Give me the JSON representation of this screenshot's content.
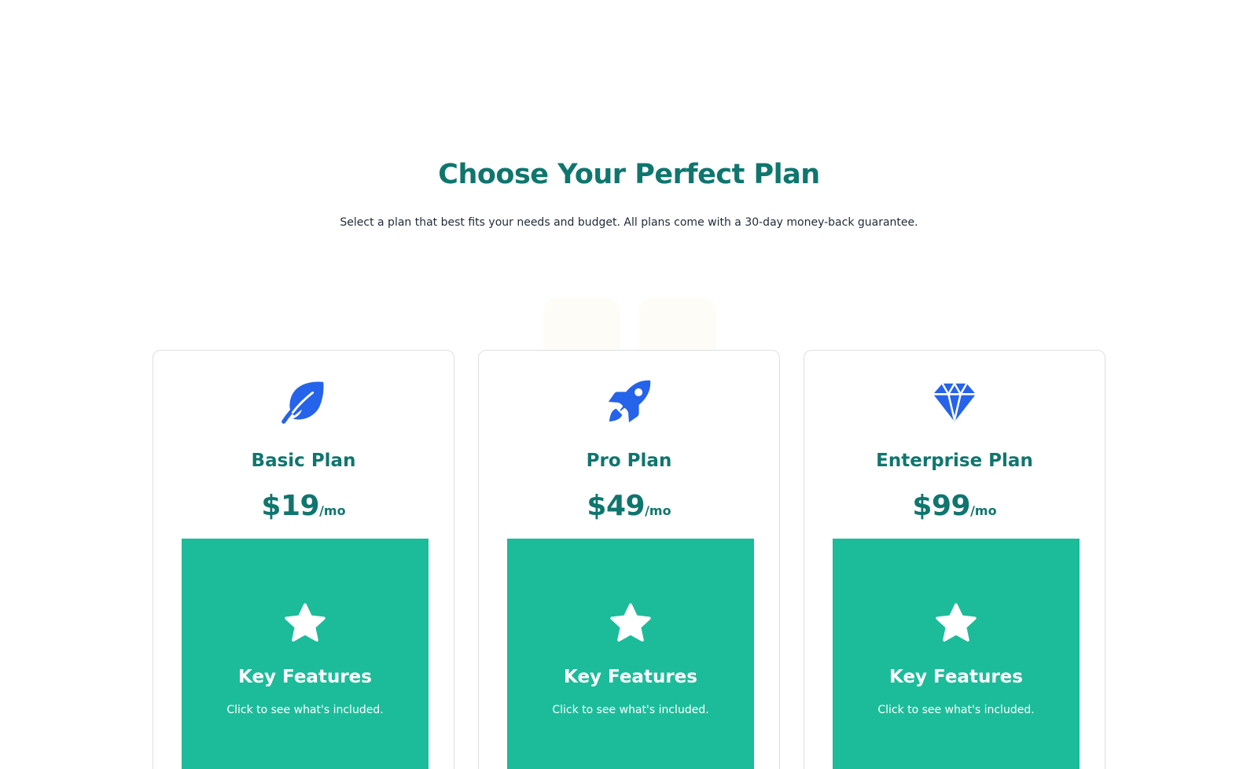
{
  "header": {
    "title": "Choose Your Perfect Plan",
    "subtitle": "Select a plan that best fits your needs and budget. All plans come with a 30-day money-back guarantee."
  },
  "colors": {
    "heading": "#0f766e",
    "icon": "#2563eb",
    "feature_panel": "#1cbc9a",
    "card_border": "#dcdfe3"
  },
  "plans": [
    {
      "icon": "leaf-icon",
      "name": "Basic Plan",
      "price": "$19",
      "period": "/mo",
      "features_title": "Key Features",
      "features_hint": "Click to see what's included.",
      "features_icon": "star-icon"
    },
    {
      "icon": "rocket-icon",
      "name": "Pro Plan",
      "price": "$49",
      "period": "/mo",
      "features_title": "Key Features",
      "features_hint": "Click to see what's included.",
      "features_icon": "star-icon"
    },
    {
      "icon": "gem-icon",
      "name": "Enterprise Plan",
      "price": "$99",
      "period": "/mo",
      "features_title": "Key Features",
      "features_hint": "Click to see what's included.",
      "features_icon": "star-icon"
    }
  ]
}
